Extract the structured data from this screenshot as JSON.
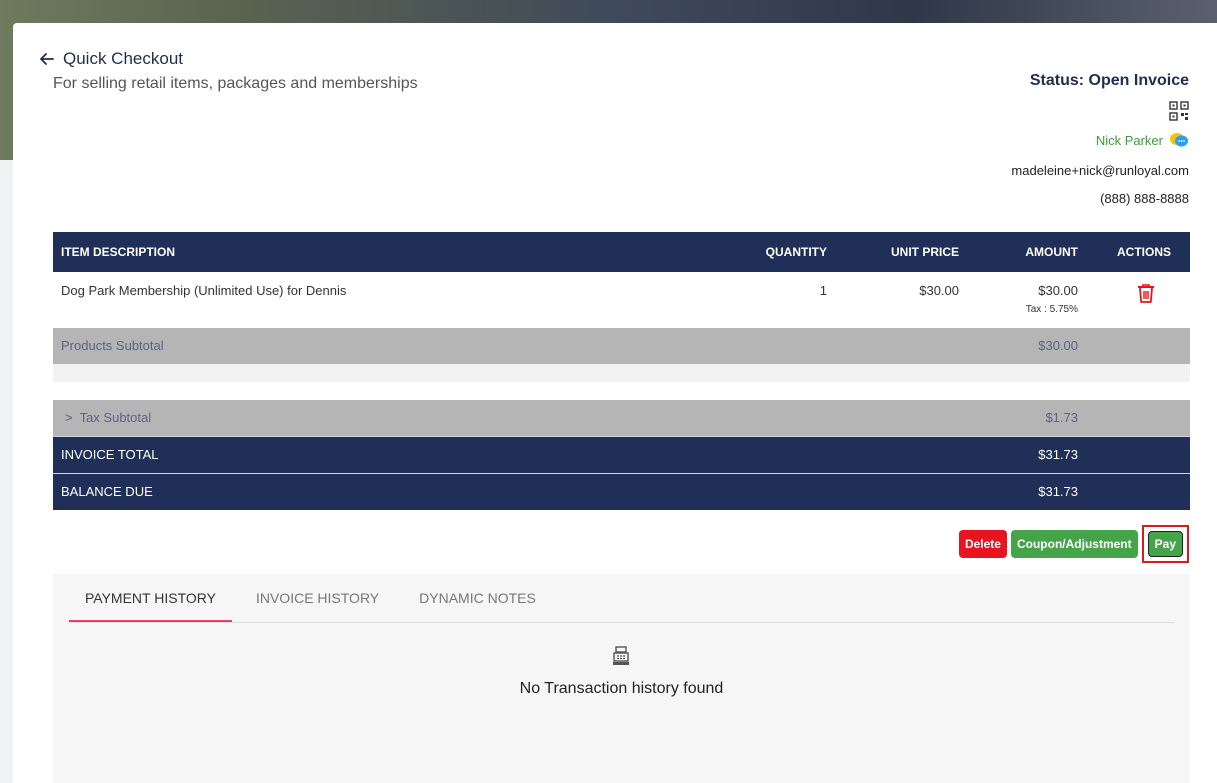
{
  "header": {
    "title": "Quick Checkout",
    "subtitle": "For selling retail items, packages and memberships"
  },
  "customer": {
    "status": "Status: Open Invoice",
    "name": "Nick Parker",
    "email": "madeleine+nick@runloyal.com",
    "phone": "(888) 888-8888"
  },
  "table": {
    "headers": {
      "description": "ITEM DESCRIPTION",
      "quantity": "QUANTITY",
      "unit_price": "UNIT PRICE",
      "amount": "AMOUNT",
      "actions": "ACTIONS"
    },
    "items": [
      {
        "description": "Dog Park Membership (Unlimited Use) for Dennis",
        "quantity": "1",
        "unit_price": "$30.00",
        "amount": "$30.00",
        "tax_note": "Tax : 5.75%"
      }
    ],
    "products_subtotal_label": "Products Subtotal",
    "products_subtotal_value": "$30.00",
    "tax_subtotal_label": ">  Tax Subtotal",
    "tax_subtotal_value": "$1.73",
    "invoice_total_label": "INVOICE TOTAL",
    "invoice_total_value": "$31.73",
    "balance_due_label": "BALANCE DUE",
    "balance_due_value": "$31.73"
  },
  "actions": {
    "delete": "Delete",
    "coupon": "Coupon/Adjustment",
    "pay": "Pay"
  },
  "history": {
    "tabs": [
      "PAYMENT HISTORY",
      "INVOICE HISTORY",
      "DYNAMIC NOTES"
    ],
    "empty_message": "No Transaction history found"
  },
  "colors": {
    "navy": "#1f2f57",
    "green": "#45a34a",
    "red": "#e8141f",
    "accent_tab": "#e83e6c"
  }
}
